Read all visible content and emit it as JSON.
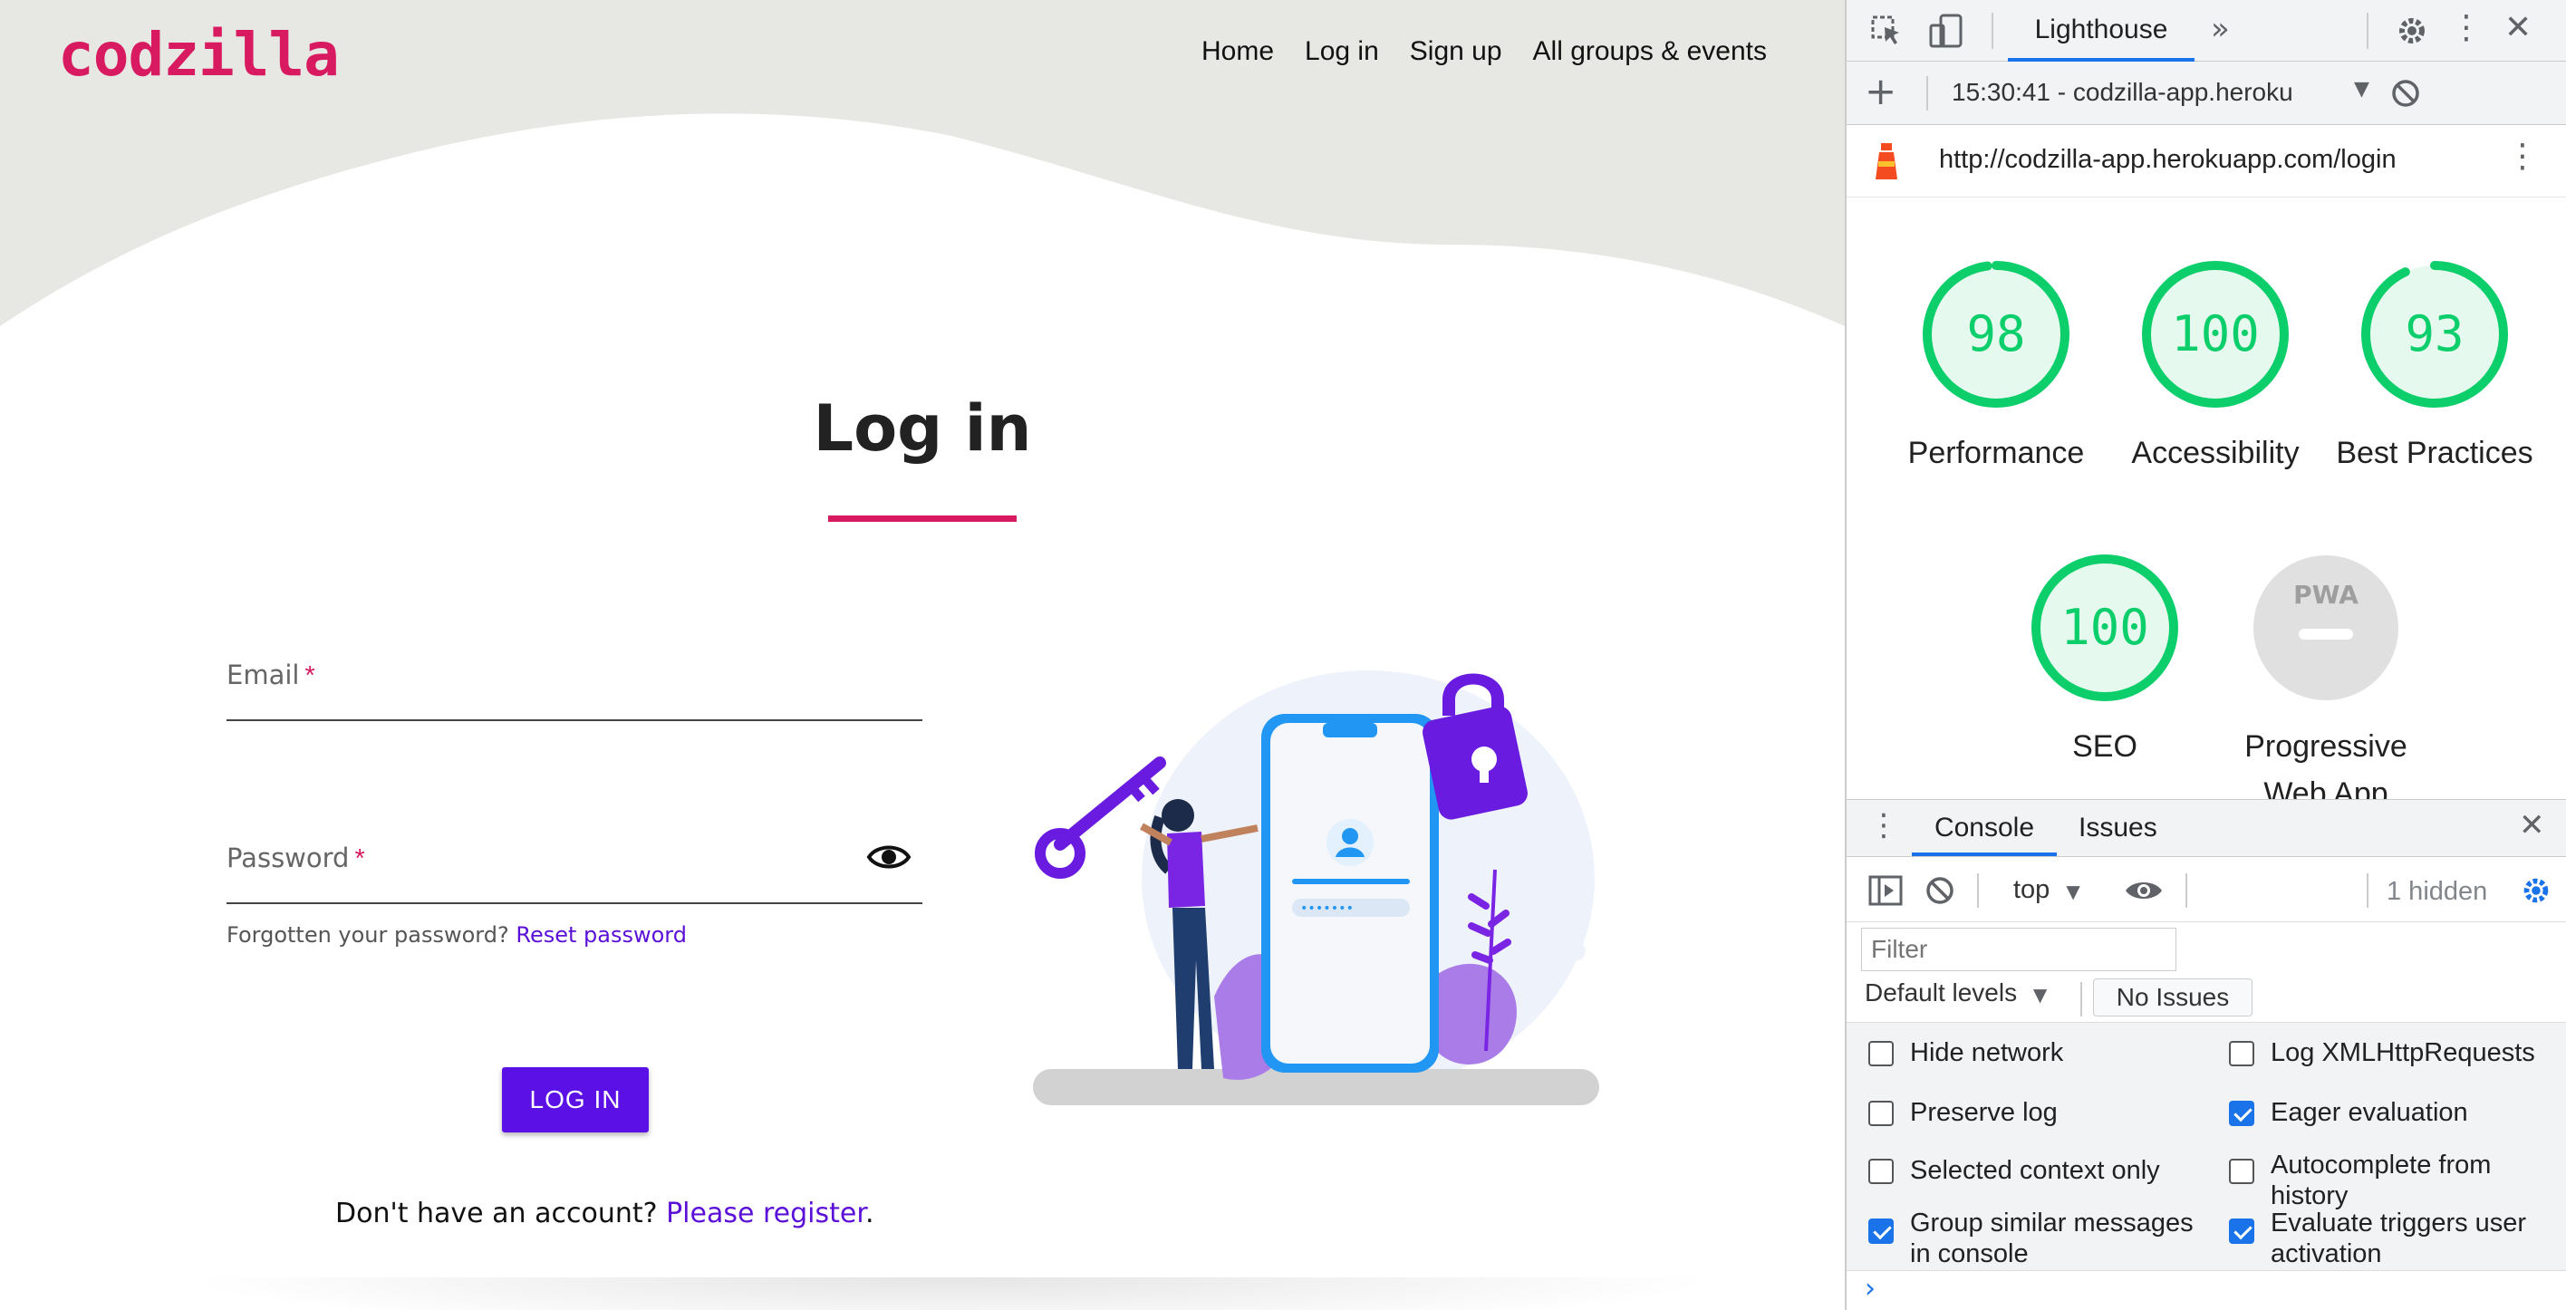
{
  "site": {
    "logo": "codzilla",
    "nav": [
      "Home",
      "Log in",
      "Sign up",
      "All groups & events"
    ],
    "page_title": "Log in",
    "form": {
      "email_label": "Email",
      "password_label": "Password",
      "required_mark": "*",
      "forgot_text": "Forgotten your password?",
      "reset_link": "Reset password",
      "login_button": "LOG IN",
      "register_text": "Don't have an account?",
      "register_link": "Please register",
      "register_end": "."
    },
    "colors": {
      "brand": "#d81b60",
      "primary": "#5b10e6",
      "wave": "#e7e7e3"
    }
  },
  "devtools": {
    "active_tab": "Lighthouse",
    "report_select": "15:30:41 - codzilla-app.heroku",
    "url": "http://codzilla-app.herokuapp.com/login",
    "scores": [
      {
        "label": "Performance",
        "value": "98",
        "fraction": 0.98
      },
      {
        "label": "Accessibility",
        "value": "100",
        "fraction": 1.0
      },
      {
        "label": "Best Practices",
        "value": "93",
        "fraction": 0.93
      },
      {
        "label": "SEO",
        "value": "100",
        "fraction": 1.0
      },
      {
        "label": "Progressive Web App",
        "value": "—",
        "fraction": 0
      }
    ],
    "pwa_badge": "PWA",
    "console": {
      "tabs": [
        "Console",
        "Issues"
      ],
      "context": "top",
      "hidden": "1 hidden",
      "filter_placeholder": "Filter",
      "levels": "Default levels",
      "issues_button": "No Issues",
      "settings": [
        {
          "label": "Hide network",
          "checked": false
        },
        {
          "label": "Log XMLHttpRequests",
          "checked": false
        },
        {
          "label": "Preserve log",
          "checked": false
        },
        {
          "label": "Eager evaluation",
          "checked": true
        },
        {
          "label": "Selected context only",
          "checked": false
        },
        {
          "label": "Autocomplete from history",
          "checked": false
        },
        {
          "label": "Group similar messages in console",
          "checked": true
        },
        {
          "label": "Evaluate triggers user activation",
          "checked": true
        }
      ]
    },
    "colors": {
      "score_good": "#0cce6b",
      "accent": "#1a73e8"
    }
  }
}
